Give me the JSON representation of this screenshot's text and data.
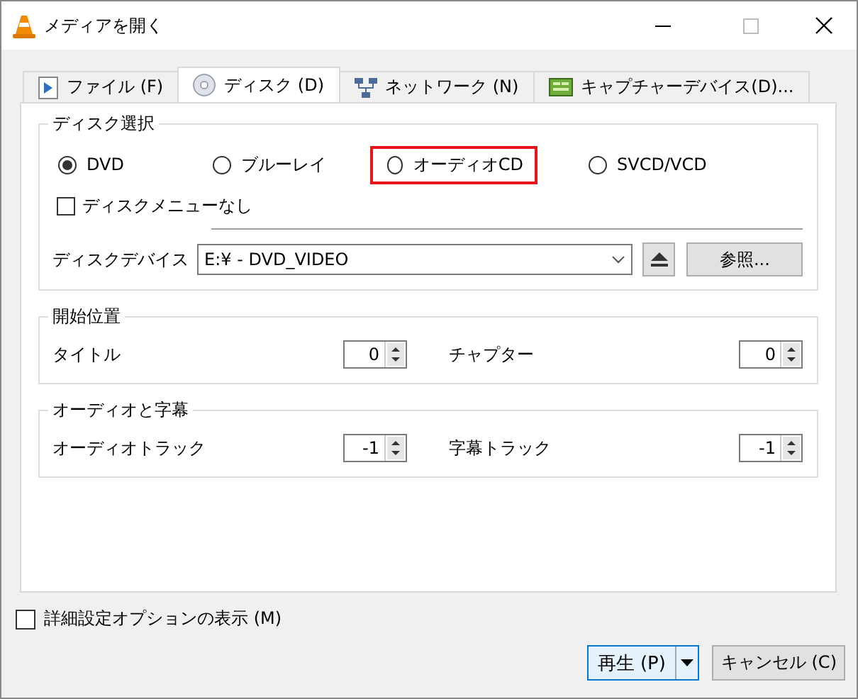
{
  "window": {
    "title": "メディアを開く"
  },
  "tabs": [
    {
      "label": "ファイル (F)",
      "kind": "file",
      "selected": false
    },
    {
      "label": "ディスク (D)",
      "kind": "disc",
      "selected": true
    },
    {
      "label": "ネットワーク (N)",
      "kind": "network",
      "selected": false
    },
    {
      "label": "キャプチャーデバイス(D)...",
      "kind": "capture",
      "selected": false
    }
  ],
  "disc_selection": {
    "title": "ディスク選択",
    "options": [
      {
        "label": "DVD",
        "selected": true,
        "highlighted": false
      },
      {
        "label": "ブルーレイ",
        "selected": false,
        "highlighted": false
      },
      {
        "label": "オーディオCD",
        "selected": false,
        "highlighted": true
      },
      {
        "label": "SVCD/VCD",
        "selected": false,
        "highlighted": false
      }
    ],
    "no_disc_menu": {
      "label": "ディスクメニューなし",
      "checked": false
    },
    "device": {
      "label": "ディスクデバイス",
      "value": "E:¥ - DVD_VIDEO"
    },
    "browse_button": "参照..."
  },
  "start_position": {
    "title": "開始位置",
    "fields": [
      {
        "label": "タイトル",
        "value": "0"
      },
      {
        "label": "チャプター",
        "value": "0"
      }
    ]
  },
  "audio_subtitles": {
    "title": "オーディオと字幕",
    "fields": [
      {
        "label": "オーディオトラック",
        "value": "-1"
      },
      {
        "label": "字幕トラック",
        "value": "-1"
      }
    ]
  },
  "advanced_options": {
    "label": "詳細設定オプションの表示 (M)",
    "checked": false
  },
  "play_button": "再生 (P)",
  "cancel_button": "キャンセル (C)"
}
